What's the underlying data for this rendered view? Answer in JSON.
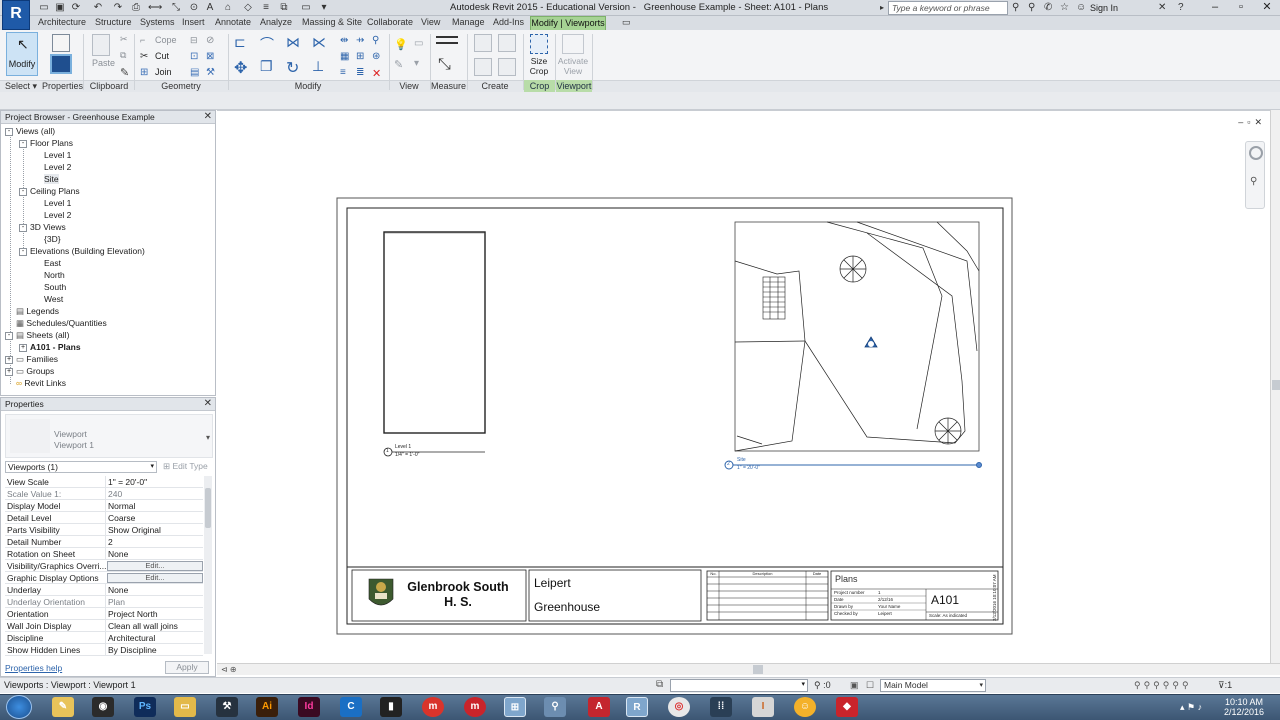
{
  "window": {
    "title": "Autodesk Revit 2015 - Educational Version -   Greenhouse Example - Sheet: A101 - Plans",
    "search_placeholder": "Type a keyword or phrase",
    "sign_in": "Sign In"
  },
  "tabs": [
    "Architecture",
    "Structure",
    "Systems",
    "Insert",
    "Annotate",
    "Analyze",
    "Massing & Site",
    "Collaborate",
    "View",
    "Manage",
    "Add-Ins"
  ],
  "active_tab": "Modify | Viewports",
  "ribbon": {
    "modify_label": "Modify",
    "paste_label": "Paste",
    "cope_label": "Cope",
    "cut_label": "Cut",
    "join_label": "Join",
    "size_crop_label": "Size\nCrop",
    "activate_view_label": "Activate\nView",
    "panels": [
      "Select",
      "Properties",
      "Clipboard",
      "Geometry",
      "Modify",
      "View",
      "Measure",
      "Create",
      "Crop",
      "Viewport"
    ]
  },
  "project_browser": {
    "title": "Project Browser - Greenhouse Example",
    "items": [
      {
        "label": "Views (all)",
        "toggle": "-"
      },
      {
        "label": "Floor Plans",
        "toggle": "-"
      },
      {
        "label": "Level 1",
        "toggle": ""
      },
      {
        "label": "Level 2",
        "toggle": ""
      },
      {
        "label": "Site",
        "toggle": ""
      },
      {
        "label": "Ceiling Plans",
        "toggle": "-"
      },
      {
        "label": "Level 1",
        "toggle": ""
      },
      {
        "label": "Level 2",
        "toggle": ""
      },
      {
        "label": "3D Views",
        "toggle": "-"
      },
      {
        "label": "{3D}",
        "toggle": ""
      },
      {
        "label": "Elevations (Building Elevation)",
        "toggle": "-"
      },
      {
        "label": "East",
        "toggle": ""
      },
      {
        "label": "North",
        "toggle": ""
      },
      {
        "label": "South",
        "toggle": ""
      },
      {
        "label": "West",
        "toggle": ""
      },
      {
        "label": "Legends",
        "toggle": ""
      },
      {
        "label": "Schedules/Quantities",
        "toggle": ""
      },
      {
        "label": "Sheets (all)",
        "toggle": "-"
      },
      {
        "label": "A101 - Plans",
        "toggle": "+"
      },
      {
        "label": "Families",
        "toggle": "+"
      },
      {
        "label": "Groups",
        "toggle": "+"
      },
      {
        "label": "Revit Links",
        "toggle": ""
      }
    ]
  },
  "properties": {
    "title": "Properties",
    "type_line1": "Viewport",
    "type_line2": "Viewport 1",
    "selector": "Viewports (1)",
    "edit_type": "Edit Type",
    "rows": [
      {
        "key": "View Scale",
        "value": "1\" = 20'-0\""
      },
      {
        "key": "Scale Value    1:",
        "value": "240"
      },
      {
        "key": "Display Model",
        "value": "Normal"
      },
      {
        "key": "Detail Level",
        "value": "Coarse"
      },
      {
        "key": "Parts Visibility",
        "value": "Show Original"
      },
      {
        "key": "Detail Number",
        "value": "2"
      },
      {
        "key": "Rotation on Sheet",
        "value": "None"
      },
      {
        "key": "Visibility/Graphics Overri...",
        "value": "Edit..."
      },
      {
        "key": "Graphic Display Options",
        "value": "Edit..."
      },
      {
        "key": "Underlay",
        "value": "None"
      },
      {
        "key": "Underlay Orientation",
        "value": "Plan"
      },
      {
        "key": "Orientation",
        "value": "Project North"
      },
      {
        "key": "Wall Join Display",
        "value": "Clean all wall joins"
      },
      {
        "key": "Discipline",
        "value": "Architectural"
      },
      {
        "key": "Show Hidden Lines",
        "value": "By Discipline"
      }
    ],
    "help_link": "Properties help",
    "apply": "Apply"
  },
  "sheet": {
    "viewport1_title": "Level 1",
    "viewport1_scale": "1/4\" = 1'-0\"",
    "viewport1_number": "1",
    "viewport2_title": "Site",
    "viewport2_scale": "1\" = 20'-0\"",
    "viewport2_number": "2",
    "school_line1": "Glenbrook South",
    "school_line2": "H. S.",
    "owner": "Leipert",
    "project": "Greenhouse",
    "rev_headers": [
      "No.",
      "Description",
      "Date"
    ],
    "sheet_name": "Plans",
    "sheet_number": "A101",
    "info_rows": [
      {
        "k": "Project number",
        "v": "1"
      },
      {
        "k": "Date",
        "v": "2/12/16"
      },
      {
        "k": "Drawn by",
        "v": "Your Name"
      },
      {
        "k": "Checked by",
        "v": "Leipert"
      }
    ],
    "scale_text": "Scale: As indicated",
    "side_stamp": "2/12/2016 10:10:07 AM"
  },
  "status": {
    "text": "Viewports : Viewport : Viewport 1",
    "model": "Main Model",
    "zero": ":0"
  },
  "taskbar": {
    "time": "10:10 AM",
    "date": "2/12/2016"
  }
}
